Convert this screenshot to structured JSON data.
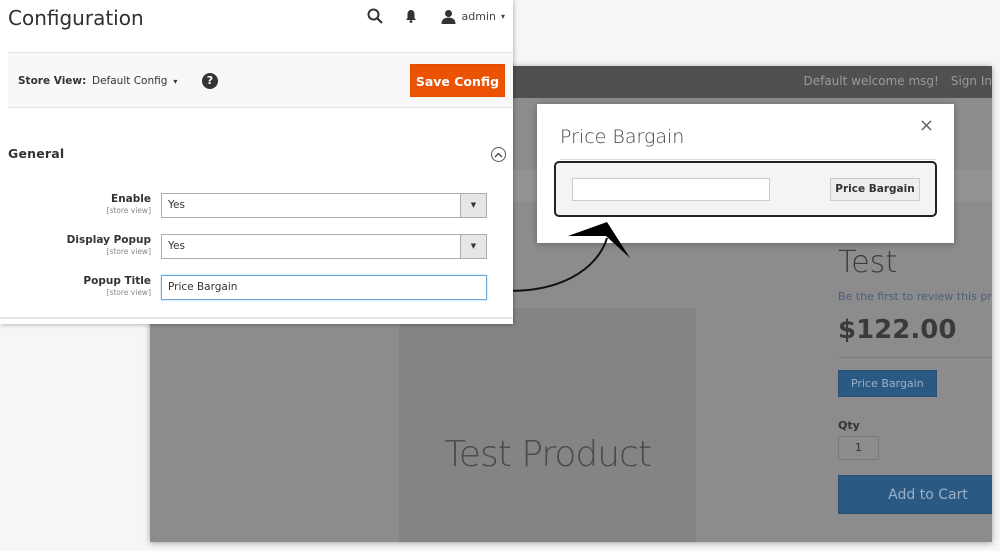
{
  "admin": {
    "page_title": "Configuration",
    "header": {
      "search_icon": "search-icon",
      "notification_icon": "bell-icon",
      "user_icon": "user-icon",
      "user_name": "admin",
      "user_caret": "▾"
    },
    "store_bar": {
      "label": "Store View:",
      "selected": "Default Config",
      "caret": "▾",
      "help": "?",
      "save_button": "Save Config"
    },
    "section": {
      "title": "General",
      "collapse_icon": "chevron-up-circle-icon",
      "fields": [
        {
          "label": "Enable",
          "scope": "[store view]",
          "type": "select",
          "value": "Yes"
        },
        {
          "label": "Display Popup",
          "scope": "[store view]",
          "type": "select",
          "value": "Yes"
        },
        {
          "label": "Popup Title",
          "scope": "[store view]",
          "type": "text",
          "value": "Price Bargain"
        }
      ],
      "dropdown_glyph": "▼"
    }
  },
  "storefront": {
    "welcome": "Default welcome msg!",
    "sign_in": "Sign In",
    "product_image_text": "Test Product",
    "product_name": "Test",
    "review_link": "Be the first to review this product",
    "price": "$122.00",
    "bargain_button": "Price Bargain",
    "qty_label": "Qty",
    "qty_value": "1",
    "add_to_cart": "Add to Cart"
  },
  "modal": {
    "title": "Price Bargain",
    "close": "×",
    "input_value": "",
    "button": "Price Bargain"
  },
  "colors": {
    "save_button": "#eb5202",
    "storefront_button": "#2a5a83",
    "focus_border": "#68a8e0"
  }
}
